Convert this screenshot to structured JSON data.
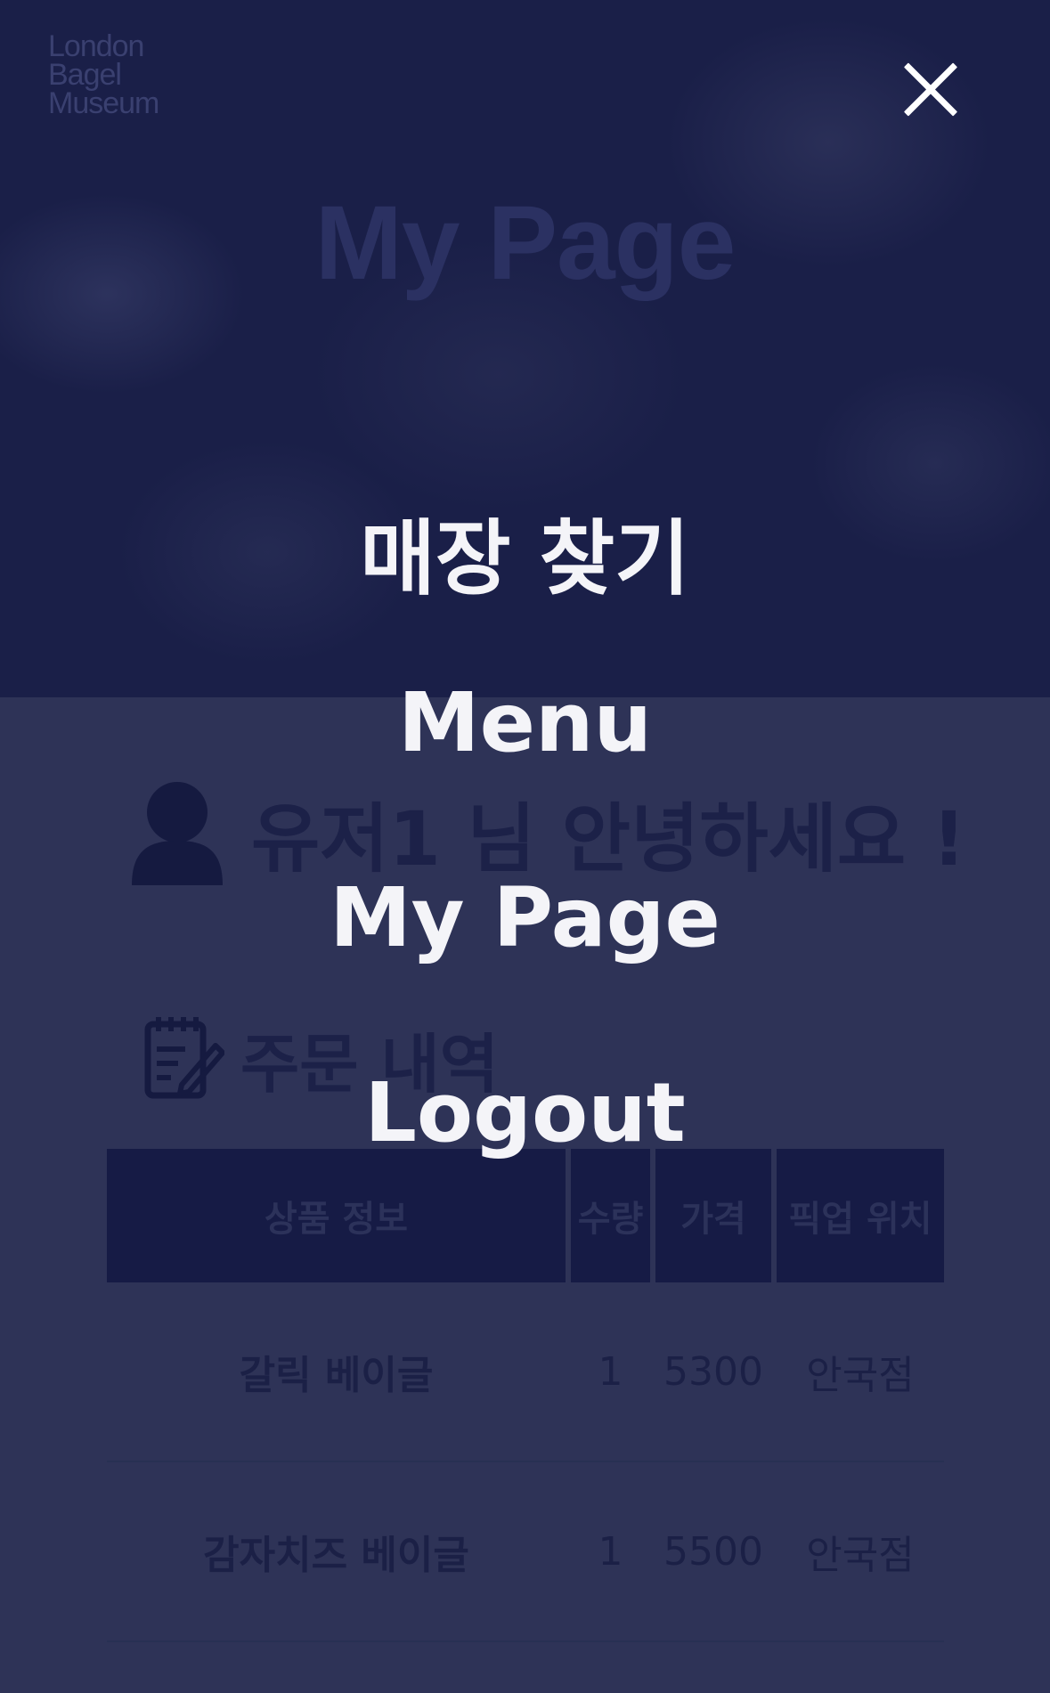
{
  "brand": {
    "logo_lines": [
      "London",
      "Bagel",
      "Museum"
    ]
  },
  "hero": {
    "title": "My Page"
  },
  "greeting": {
    "text": "유저1 님 안녕하세요 !"
  },
  "orders": {
    "title": "주문 내역",
    "columns": [
      "상품 정보",
      "수량",
      "가격",
      "픽업 위치"
    ],
    "rows": [
      {
        "product": "갈릭 베이글",
        "quantity": "1",
        "price": "5300",
        "pickup": "안국점"
      },
      {
        "product": "감자치즈 베이글",
        "quantity": "1",
        "price": "5500",
        "pickup": "안국점"
      }
    ]
  },
  "menu": {
    "close_icon": "close-icon",
    "items": [
      "매장 찾기",
      "Menu",
      "My Page",
      "Logout"
    ]
  },
  "colors": {
    "overlay_text": "#f4f4f8",
    "hero_bg": "#1a1f48",
    "body_bg": "#2e3357",
    "table_header": "#161b45"
  }
}
